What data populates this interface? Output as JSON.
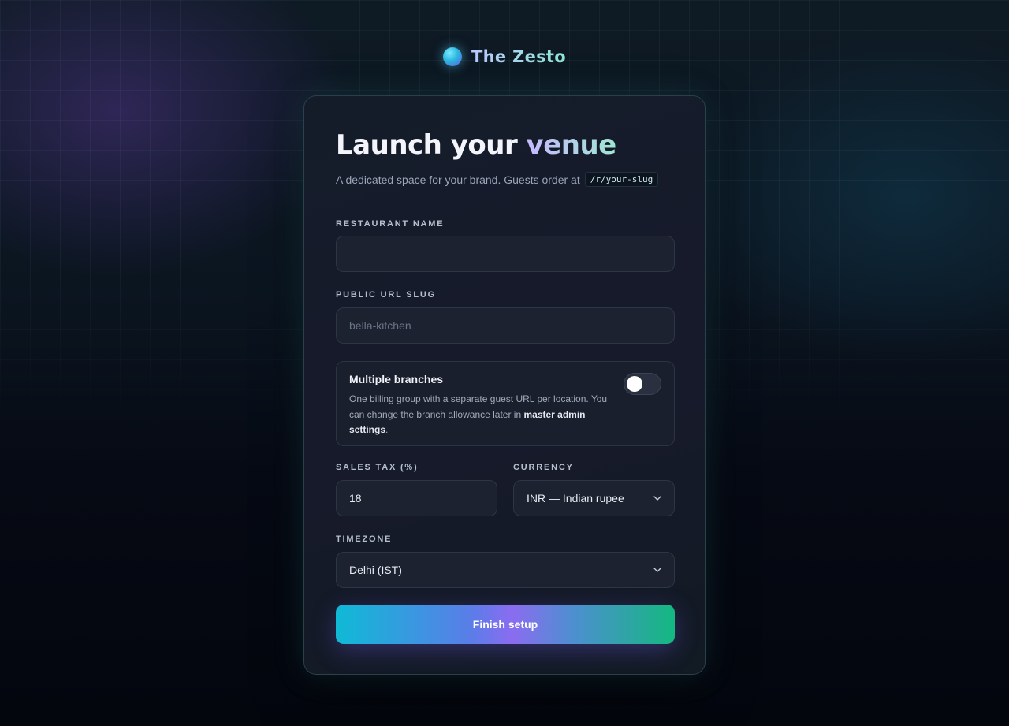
{
  "brand": {
    "name": "The Zesto"
  },
  "header": {
    "title_main": "Launch your ",
    "title_accent": "venue",
    "subtitle": "A dedicated space for your brand. Guests order at",
    "slug_example": "/r/your-slug"
  },
  "form": {
    "restaurant_name": {
      "label": "Restaurant name",
      "value": "",
      "placeholder": ""
    },
    "slug": {
      "label": "Public URL slug",
      "value": "",
      "placeholder": "bella-kitchen"
    },
    "branches": {
      "title": "Multiple branches",
      "desc_pre": "One billing group with a separate guest URL per location. You can change the branch allowance later in ",
      "desc_bold": "master admin settings",
      "desc_post": ".",
      "enabled": false
    },
    "sales_tax": {
      "label": "Sales tax (%)",
      "value": "18"
    },
    "currency": {
      "label": "Currency",
      "value": "INR — Indian rupee"
    },
    "timezone": {
      "label": "Timezone",
      "value": "Delhi (IST)"
    },
    "submit_label": "Finish setup"
  },
  "colors": {
    "accent_start": "#0fbad6",
    "accent_mid": "#8b6cf0",
    "accent_end": "#14b880"
  }
}
